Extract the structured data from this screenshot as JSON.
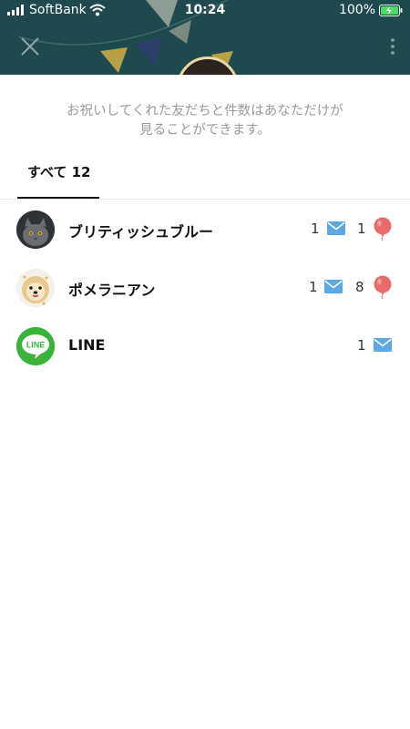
{
  "status_bar": {
    "carrier": "SoftBank",
    "time": "10:24",
    "battery": "100%"
  },
  "notice": {
    "line1": "お祝いしてくれた友だちと件数はあなただけが",
    "line2": "見ることができます。"
  },
  "tabs": [
    {
      "label": "すべて 12",
      "active": true
    }
  ],
  "list": [
    {
      "name": "ブリティッシュブルー",
      "messages": "1",
      "balloons": "1",
      "avatar": "cat-photo"
    },
    {
      "name": "ポメラニアン",
      "messages": "1",
      "balloons": "8",
      "avatar": "dog-photo"
    },
    {
      "name": "LINE",
      "messages": "1",
      "balloons": null,
      "avatar": "line-logo",
      "logo_text": "LINE"
    }
  ],
  "colors": {
    "header": "#1f4a4d",
    "message_icon": "#5aa8e6",
    "balloon_icon": "#e86a6a",
    "line_green": "#3bb33b"
  }
}
